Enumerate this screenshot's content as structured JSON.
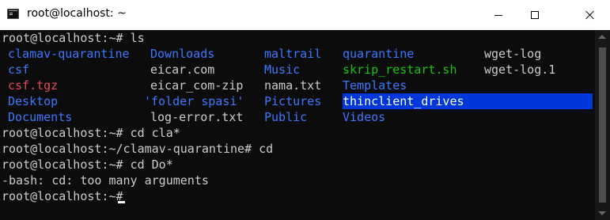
{
  "window": {
    "title": "root@localhost: ~",
    "icon": "terminal-icon",
    "controls": [
      "minimize-icon",
      "maximize-icon",
      "close-icon"
    ]
  },
  "colors": {
    "background": "#0c0c0c",
    "text": "#cccccc",
    "directory": "#3b78ff",
    "executable": "#16c60c",
    "archive": "#e74856",
    "selection": "#0037da"
  },
  "terminal": {
    "prompt_ls": "root@localhost:~# ls",
    "ls_rows": [
      [
        {
          "name": "clamav-quarantine",
          "type": "dir"
        },
        {
          "name": "Downloads",
          "type": "dir"
        },
        {
          "name": "maltrail",
          "type": "dir"
        },
        {
          "name": "quarantine",
          "type": "dir"
        },
        {
          "name": "wget-log",
          "type": "file"
        }
      ],
      [
        {
          "name": "csf",
          "type": "dir"
        },
        {
          "name": "eicar.com",
          "type": "file"
        },
        {
          "name": "Music",
          "type": "dir"
        },
        {
          "name": "skrip_restart.sh",
          "type": "exe"
        },
        {
          "name": "wget-log.1",
          "type": "file"
        }
      ],
      [
        {
          "name": "csf.tgz",
          "type": "archive"
        },
        {
          "name": "eicar_com-zip",
          "type": "file"
        },
        {
          "name": "nama.txt",
          "type": "file"
        },
        {
          "name": "Templates",
          "type": "dir"
        }
      ],
      [
        {
          "name": "Desktop",
          "type": "dir"
        },
        {
          "name": "'folder spasi'",
          "type": "dir"
        },
        {
          "name": "Pictures",
          "type": "dir"
        },
        {
          "name": "thinclient_drives",
          "type": "highlight"
        }
      ],
      [
        {
          "name": "Documents",
          "type": "dir"
        },
        {
          "name": "log-error.txt",
          "type": "file"
        },
        {
          "name": "Public",
          "type": "dir"
        },
        {
          "name": "Videos",
          "type": "dir"
        }
      ]
    ],
    "lines_after": [
      "root@localhost:~# cd cla*",
      "root@localhost:~/clamav-quarantine# cd",
      "root@localhost:~# cd Do*",
      "-bash: cd: too many arguments",
      "root@localhost:~# "
    ]
  }
}
